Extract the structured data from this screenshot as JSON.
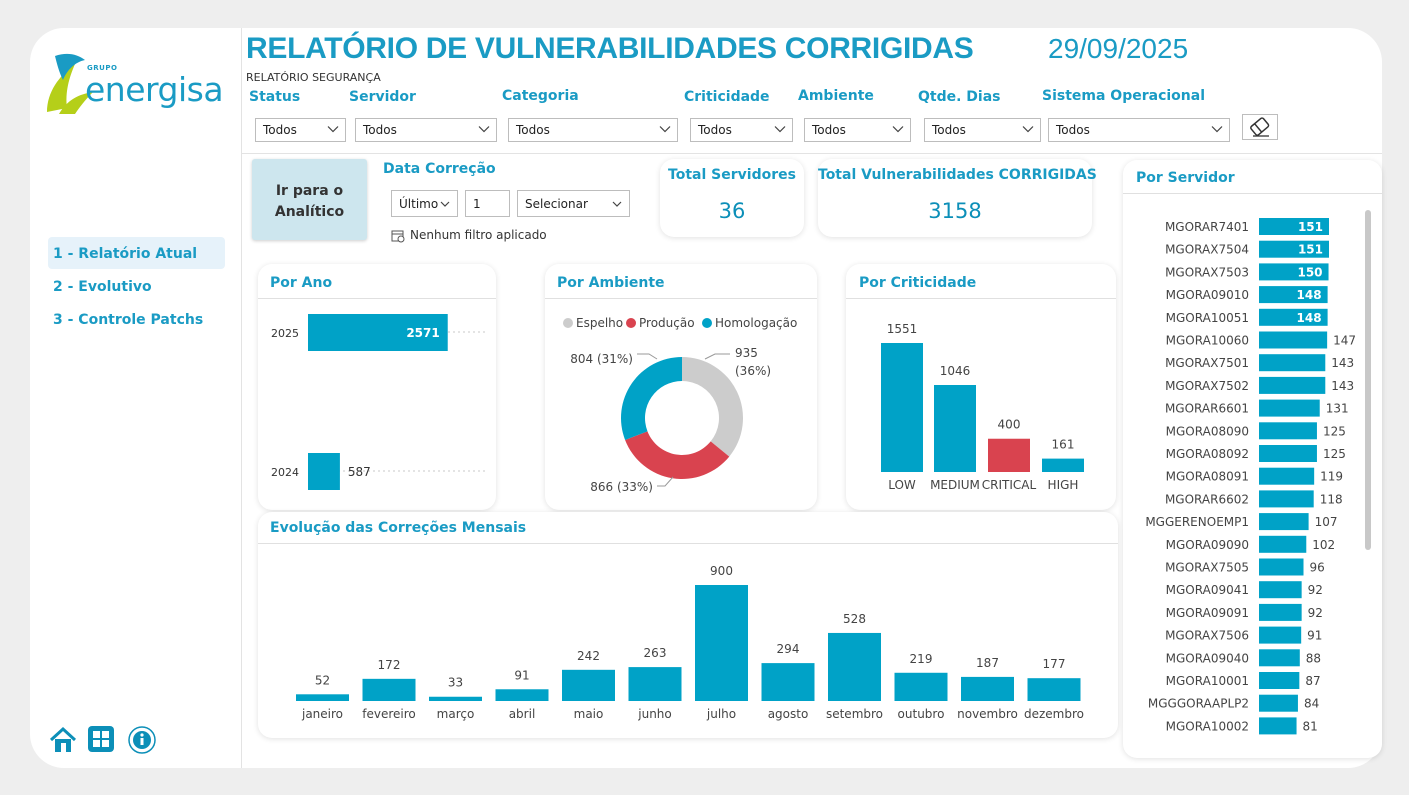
{
  "header": {
    "logo_group": "GRUPO",
    "logo_brand": "energisa",
    "title": "RELATÓRIO DE VULNERABILIDADES CORRIGIDAS",
    "date": "29/09/2025",
    "subtitle": "RELATÓRIO SEGURANÇA"
  },
  "filters": [
    {
      "label": "Status",
      "value": "Todos"
    },
    {
      "label": "Servidor",
      "value": "Todos"
    },
    {
      "label": "Categoria",
      "value": "Todos"
    },
    {
      "label": "Criticidade",
      "value": "Todos"
    },
    {
      "label": "Ambiente",
      "value": "Todos"
    },
    {
      "label": "Qtde. Dias",
      "value": "Todos"
    },
    {
      "label": "Sistema Operacional",
      "value": "Todos"
    }
  ],
  "nav": {
    "items": [
      "1 - Relatório Atual",
      "2 - Evolutivo",
      "3 - Controle Patchs"
    ],
    "active_index": 0
  },
  "analytic_button": {
    "line1": "Ir para o",
    "line2": "Analítico"
  },
  "date_filter": {
    "label": "Data Correção",
    "mode": "Último",
    "count": "1",
    "unit": "Selecionar",
    "note": "Nenhum filtro aplicado"
  },
  "kpis": {
    "servers": {
      "label": "Total Servidores",
      "value": "36"
    },
    "vulns": {
      "label": "Total Vulnerabilidades CORRIGIDAS",
      "value": "3158"
    }
  },
  "colors": {
    "accent": "#1a9bc4",
    "bar": "#00a2c7",
    "red": "#d9434f",
    "gray": "#cccccc",
    "brand_green": "#b5cf19"
  },
  "chart_data": [
    {
      "title": "Por Ano",
      "type": "bar",
      "orientation": "horizontal",
      "categories": [
        "2025",
        "2024"
      ],
      "values": [
        2571,
        587
      ]
    },
    {
      "title": "Por Ambiente",
      "type": "pie",
      "donut": true,
      "legend": "top",
      "slices": [
        {
          "name": "Espelho",
          "value": 935,
          "label": "935",
          "pct": "(36%)",
          "color": "#cccccc"
        },
        {
          "name": "Produção",
          "value": 866,
          "label": "866 (33%)",
          "color": "#d9434f"
        },
        {
          "name": "Homologação",
          "value": 804,
          "label": "804 (31%)",
          "color": "#00a2c7"
        }
      ]
    },
    {
      "title": "Por Criticidade",
      "type": "bar",
      "categories": [
        "LOW",
        "MEDIUM",
        "CRITICAL",
        "HIGH"
      ],
      "values": [
        1551,
        1046,
        400,
        161
      ],
      "colors": [
        "#00a2c7",
        "#00a2c7",
        "#d9434f",
        "#00a2c7"
      ]
    },
    {
      "title": "Evolução das Correções Mensais",
      "type": "bar",
      "categories": [
        "janeiro",
        "fevereiro",
        "março",
        "abril",
        "maio",
        "junho",
        "julho",
        "agosto",
        "setembro",
        "outubro",
        "novembro",
        "dezembro"
      ],
      "values": [
        52,
        172,
        33,
        91,
        242,
        263,
        900,
        294,
        528,
        219,
        187,
        177
      ]
    },
    {
      "title": "Por Servidor",
      "type": "bar",
      "orientation": "horizontal",
      "categories": [
        "MGORAR7401",
        "MGORAX7504",
        "MGORAX7503",
        "MGORA09010",
        "MGORA10051",
        "MGORA10060",
        "MGORAX7501",
        "MGORAX7502",
        "MGORAR6601",
        "MGORA08090",
        "MGORA08092",
        "MGORA08091",
        "MGORAR6602",
        "MGGERENOEMP1",
        "MGORA09090",
        "MGORAX7505",
        "MGORA09041",
        "MGORA09091",
        "MGORAX7506",
        "MGORA09040",
        "MGORA10001",
        "MGGGORAAPLP2",
        "MGORA10002"
      ],
      "values": [
        151,
        151,
        150,
        148,
        148,
        147,
        143,
        143,
        131,
        125,
        125,
        119,
        118,
        107,
        102,
        96,
        92,
        92,
        91,
        88,
        87,
        84,
        81
      ]
    }
  ]
}
